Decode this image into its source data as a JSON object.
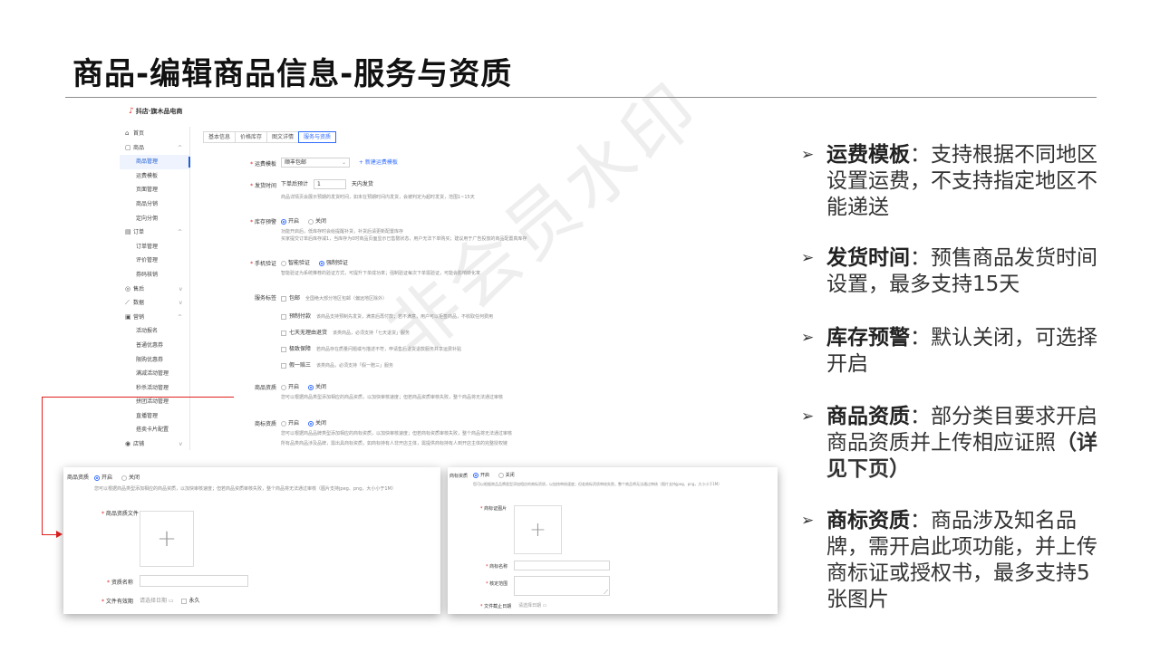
{
  "slide": {
    "title": "商品-编辑商品信息-服务与资质"
  },
  "app": {
    "logo": "抖店·旗木品电商",
    "logo_mark": "♪",
    "sidebar": [
      {
        "label": "首页",
        "icon": "home-icon",
        "glyph": "⌂",
        "group": true
      },
      {
        "label": "商品",
        "icon": "bag-icon",
        "glyph": "▢",
        "group": true,
        "arrow": "^"
      },
      {
        "label": "商品管理",
        "active": true
      },
      {
        "label": "运费模板"
      },
      {
        "label": "页面管理"
      },
      {
        "label": "商品分销"
      },
      {
        "label": "定向分佣"
      },
      {
        "label": "订单",
        "icon": "order-icon",
        "glyph": "▤",
        "group": true,
        "arrow": "^"
      },
      {
        "label": "订单管理"
      },
      {
        "label": "评价管理"
      },
      {
        "label": "券码核销"
      },
      {
        "label": "售后",
        "icon": "shield-icon",
        "glyph": "◎",
        "group": true,
        "arrow": "v"
      },
      {
        "label": "数据",
        "icon": "chart-icon",
        "glyph": "⟋",
        "group": true,
        "arrow": "v"
      },
      {
        "label": "营销",
        "icon": "gift-icon",
        "glyph": "▣",
        "group": true,
        "arrow": "^"
      },
      {
        "label": "活动报名"
      },
      {
        "label": "普通优惠券"
      },
      {
        "label": "限购优惠券"
      },
      {
        "label": "满减活动管理"
      },
      {
        "label": "秒杀活动管理"
      },
      {
        "label": "拼团活动管理"
      },
      {
        "label": "直播管理"
      },
      {
        "label": "搭卖卡片配置"
      },
      {
        "label": "店铺",
        "icon": "store-icon",
        "glyph": "◉",
        "group": true,
        "arrow": "v"
      }
    ],
    "tabs": [
      "基本信息",
      "价格库存",
      "图文详情",
      "服务与资质"
    ],
    "form": {
      "shipping_label": "运费模板",
      "shipping_value": "顺丰包邮",
      "shipping_link": "+ 新建运费模板",
      "delivery_label": "发货时间",
      "delivery_prefix": "下单后预计",
      "delivery_value": "1",
      "delivery_suffix": "天内发货",
      "delivery_hint": "商品详情页会展示预期的发货时间，如未在预期时间内发货，会被判定为超时发货，范围1~15天",
      "stock_label": "库存预警",
      "opt_on": "开启",
      "opt_off": "关闭",
      "stock_hint1": "功能开启后，低库存时会给提醒补货，补货后请更新配置库存",
      "stock_hint2": "买家提交订单后库存减1，当库存为0时商品页面显示已售罄状态，用户无法下单购买；建议用于广告投放的商品配置真库存",
      "phone_label": "手机验证",
      "phone_opt1": "智能验证",
      "phone_opt2": "强制验证",
      "phone_hint": "智能验证为系统推荐的验证方式，可提升下单成功率；强制验证每次下单需验证，可能会影响转化率",
      "service_label": "服务标签",
      "services": [
        {
          "name": "包邮",
          "desc": "全国绝大部分地区包邮（偏远地区除外）"
        },
        {
          "name": "预制付款",
          "desc": "该商品支持预制先发货，满意后再付款；若不满意，用户可以拒签商品，不收取任何费用"
        },
        {
          "name": "七天无理由退货",
          "desc": "该类商品，必须支持「七天退货」服务"
        },
        {
          "name": "极致保障",
          "desc": "若商品存在质量问题或与描述不符，申请售后退货退款服务并享运费补贴"
        },
        {
          "name": "假一赔三",
          "desc": "该类商品，必须支持「假一赔三」服务"
        }
      ],
      "qual_label": "商品资质",
      "qual_hint": "您可以根据商品类型添加相应的商品资质，以加快审核速度；但若商品资质审核失败，整个商品将无法通过审核",
      "brand_label": "商标资质",
      "brand_hint1": "您可以根据商品品牌类型添加相应的商标资质，以加快审核速度；但若商标资质审核失败，整个商品将无法通过审核",
      "brand_hint2": "所有品类商品涉及品牌，需出具商标资质，如商标持有人非开店主体，需提供商标持有人到开店主体的完整授权链"
    }
  },
  "zoom_left": {
    "label": "商品资质",
    "opt_on": "开启",
    "opt_off": "关闭",
    "hint": "您可以根据商品类型添加相应的商品资质，以加快审核速度；但若商品资质审核失败，整个商品将无法通过审核（图片支持jpeg、png，大小小于1M）",
    "file_label": "商品资质文件",
    "name_label": "资质名称",
    "date_label": "文件有效期",
    "date_placeholder": "请选择日期",
    "permanent": "永久",
    "plus": "+"
  },
  "zoom_right": {
    "label": "商标资质",
    "opt_on": "开启",
    "opt_off": "关闭",
    "hint": "您可以根据商品品牌类型添加相应的商标资质，以加快审核速度；但若商标资质审核失败，整个商品将无法通过审核（图片支持jpeg、png，大小小于1M）",
    "image_label": "商标证图片",
    "name_label": "商标名称",
    "scope_label": "核定范围",
    "date_label": "文件截止日期",
    "date_placeholder": "请选择日期",
    "plus": "+"
  },
  "bullets": [
    {
      "key": "运费模板",
      "text": "：支持根据不同地区设置运费，不支持指定地区不能递送"
    },
    {
      "key": "发货时间",
      "text": "：预售商品发货时间设置，最多支持15天"
    },
    {
      "key": "库存预警",
      "text": "：默认关闭，可选择开启"
    },
    {
      "key": "商品资质",
      "text": "：部分类目要求开启商品资质并上传相应证照",
      "note": "（详见下页）"
    },
    {
      "key": "商标资质",
      "text": "：商品涉及知名品牌，需开启此项功能，并上传商标证或授权书，最多支持5张图片"
    }
  ],
  "bullet_marker": "➢",
  "watermark": "非会员水印",
  "colors": {
    "accent": "#2f6bff",
    "required": "#e02020",
    "connector": "#e02020"
  }
}
